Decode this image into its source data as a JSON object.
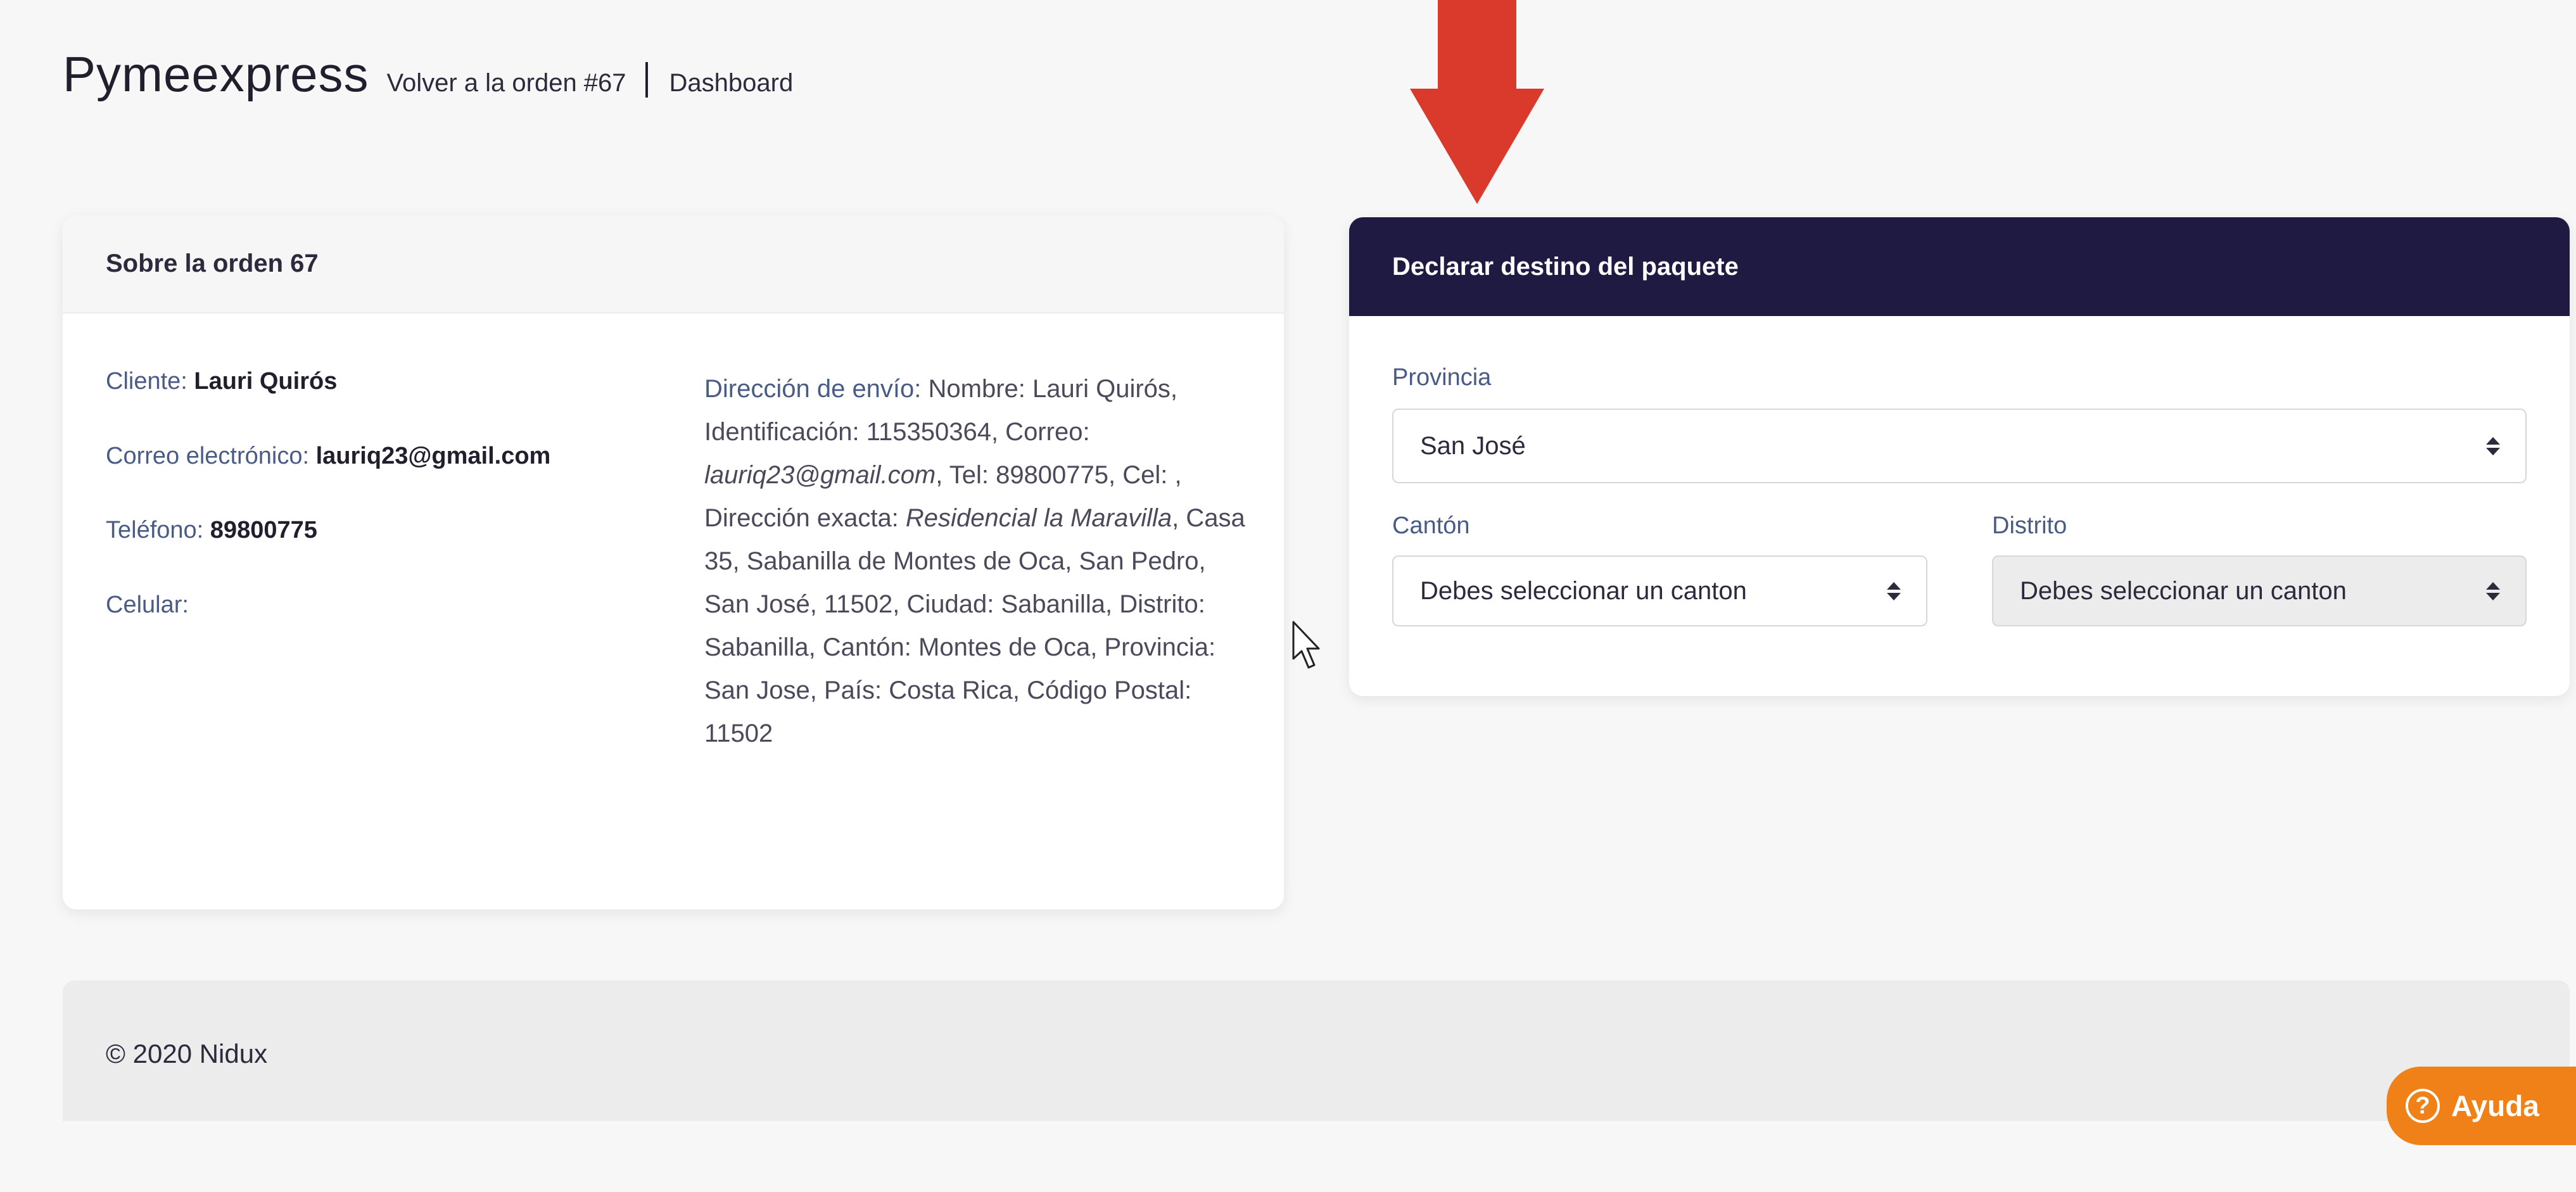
{
  "header": {
    "brand": "Pymeexpress",
    "back_link": "Volver a la orden #67",
    "dashboard_link": "Dashboard"
  },
  "order_card": {
    "title": "Sobre la orden 67",
    "client_label": "Cliente:",
    "client_value": "Lauri Quirós",
    "email_label": "Correo electrónico:",
    "email_value": "lauriq23@gmail.com",
    "phone_label": "Teléfono:",
    "phone_value": "89800775",
    "cell_label": "Celular:",
    "cell_value": "",
    "shipping_label": "Dirección de envío:",
    "shipping_part1": "Nombre: Lauri Quirós, Identificación: 115350364, Correo:",
    "shipping_email": "lauriq23@gmail.com",
    "shipping_part2": ", Tel: 89800775, Cel: ,",
    "exact_label": "Dirección exacta:",
    "exact_value": "Residencial la Maravilla",
    "exact_rest": ", Casa 35, Sabanilla de Montes de Oca, San Pedro, San José, 11502, Ciudad: Sabanilla, Distrito: Sabanilla, Cantón: Montes de Oca, Provincia: San Jose, País: Costa Rica, Código Postal: 11502"
  },
  "destination_card": {
    "title": "Declarar destino del paquete",
    "province_label": "Provincia",
    "province_value": "San José",
    "canton_label": "Cantón",
    "canton_value": "Debes seleccionar un canton",
    "district_label": "Distrito",
    "district_value": "Debes seleccionar un canton"
  },
  "footer": {
    "text": "© 2020 Nidux"
  },
  "help_button": {
    "label": "Ayuda",
    "icon": "question-circle-icon"
  },
  "colors": {
    "dark_header": "#1e1a42",
    "help_orange": "#f08118",
    "arrow_red": "#d93a2b",
    "label_blue": "#4a5b85"
  }
}
